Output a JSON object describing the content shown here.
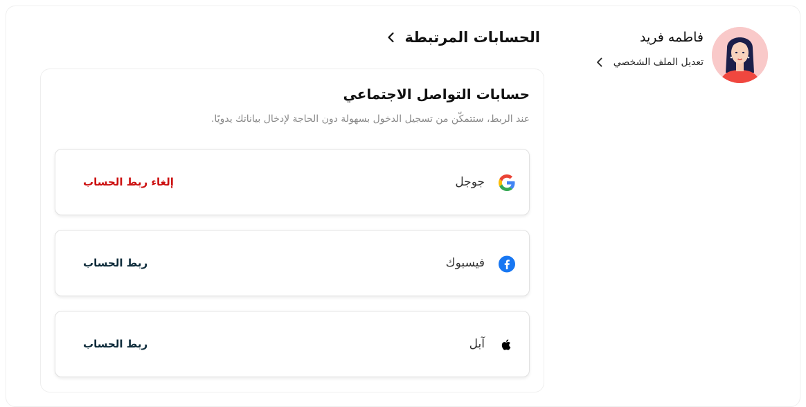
{
  "profile": {
    "name": "فاطمه فريد",
    "edit_label": "تعديل الملف الشخصي",
    "avatar_icon": "woman-avatar-icon",
    "avatar_bg": "#f9c9c9"
  },
  "header": {
    "title": "الحسابات المرتبطة",
    "back_icon": "chevron-left-icon"
  },
  "social": {
    "title": "حسابات التواصل الاجتماعي",
    "subtitle": "عند الربط، ستتمكّن من تسجيل الدخول بسهولة دون الحاجة لإدخال بياناتك يدويًا.",
    "accounts": [
      {
        "name": "جوجل",
        "icon": "google-icon",
        "action": "إلغاء ربط الحساب",
        "linked": true,
        "action_color": "#cc1010"
      },
      {
        "name": "فيسبوك",
        "icon": "facebook-icon",
        "action": "ربط الحساب",
        "linked": false,
        "action_color": "#0d2b3a"
      },
      {
        "name": "آبل",
        "icon": "apple-icon",
        "action": "ربط الحساب",
        "linked": false,
        "action_color": "#0d2b3a"
      }
    ]
  }
}
